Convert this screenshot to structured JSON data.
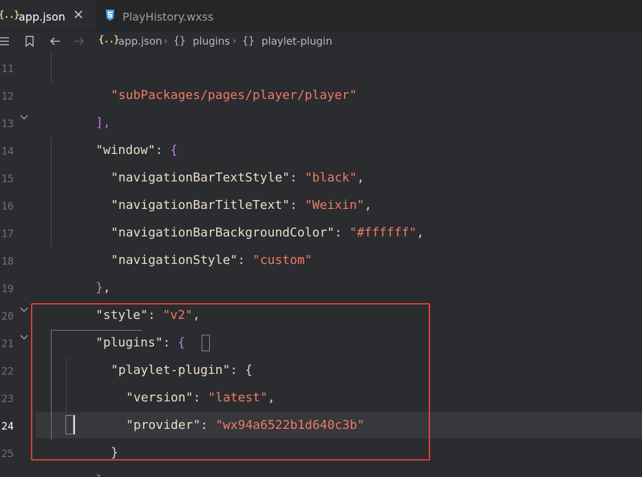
{
  "tabs": [
    {
      "label": "app.json",
      "icon": "json-brace-icon",
      "active": true
    },
    {
      "label": "PlayHistory.wxss",
      "icon": "css3-icon",
      "active": false
    }
  ],
  "breadcrumb": {
    "file_icon_glyph": "{..}",
    "brace_glyph": "{}",
    "items": [
      "app.json",
      "plugins",
      "playlet-plugin"
    ]
  },
  "tab_icon_glyph": "{..}",
  "gutter": {
    "line_numbers": [
      "11",
      "12",
      "13",
      "14",
      "15",
      "16",
      "17",
      "18",
      "19",
      "20",
      "21",
      "22",
      "23",
      "24",
      "25"
    ],
    "current_line": "24"
  },
  "code": {
    "l11": {
      "s": "\"subPackages/pages/player/player\""
    },
    "l12": {
      "p": "],"
    },
    "l13": {
      "k": "\"window\"",
      "p1": ": ",
      "b": "{"
    },
    "l14": {
      "k": "\"navigationBarTextStyle\"",
      "p1": ": ",
      "s": "\"black\"",
      "p2": ","
    },
    "l15": {
      "k": "\"navigationBarTitleText\"",
      "p1": ": ",
      "s": "\"Weixin\"",
      "p2": ","
    },
    "l16": {
      "k": "\"navigationBarBackgroundColor\"",
      "p1": ": ",
      "s": "\"#ffffff\"",
      "p2": ","
    },
    "l17": {
      "k": "\"navigationStyle\"",
      "p1": ": ",
      "s": "\"custom\""
    },
    "l18": {
      "b": "}",
      "p": ","
    },
    "l19": {
      "k": "\"style\"",
      "p1": ": ",
      "s": "\"v2\"",
      "p2": ","
    },
    "l20": {
      "k": "\"plugins\"",
      "p1": ": ",
      "b": "{"
    },
    "l21": {
      "k": "\"playlet-plugin\"",
      "p1": ": ",
      "b": "{"
    },
    "l22": {
      "k": "\"version\"",
      "p1": ": ",
      "s": "\"latest\"",
      "p2": ","
    },
    "l23": {
      "k": "\"provider\"",
      "p1": ": ",
      "s": "\"wx94a6522b1d640c3b\""
    },
    "l24": {
      "b": "}"
    },
    "l25": {
      "b": "}",
      "p": ","
    }
  },
  "colors": {
    "background": "#2a2c2f",
    "key": "#ecdcc8",
    "string": "#f17a63",
    "bracket": "#c678dd",
    "highlight_box": "#d94235",
    "json_icon": "#e2c08d",
    "css_icon": "#42a5f5"
  }
}
